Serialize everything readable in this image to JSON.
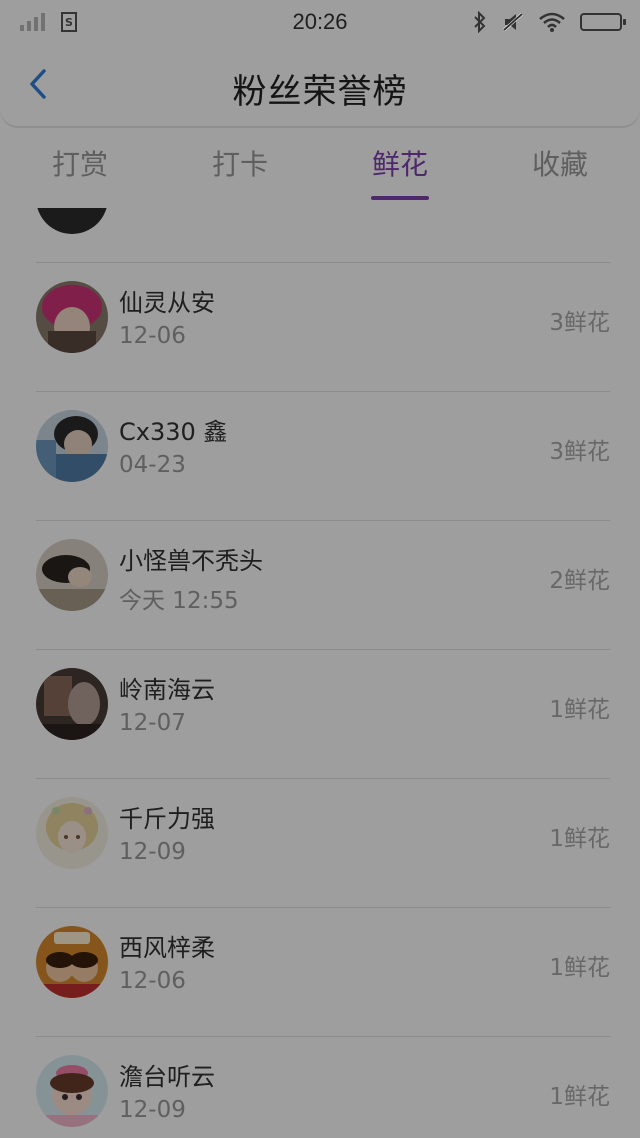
{
  "status_bar": {
    "time": "20:26",
    "sim_label": "S"
  },
  "header": {
    "title": "粉丝荣誉榜"
  },
  "tabs": [
    {
      "label": "打赏"
    },
    {
      "label": "打卡"
    },
    {
      "label": "鲜花"
    },
    {
      "label": "收藏"
    }
  ],
  "colors": {
    "accent": "#7e3fae",
    "back_icon": "#2f7fd6"
  },
  "list": [
    {
      "name": "仙灵从安",
      "date": "12-06",
      "count": "3鲜花",
      "avatar_icon": "avatar-pink-hat"
    },
    {
      "name": "Cx330 鑫",
      "date": "04-23",
      "count": "3鲜花",
      "avatar_icon": "avatar-denim"
    },
    {
      "name": "小怪兽不秃头",
      "date": "今天 12:55",
      "count": "2鲜花",
      "avatar_icon": "avatar-girl-desk"
    },
    {
      "name": "岭南海云",
      "date": "12-07",
      "count": "1鲜花",
      "avatar_icon": "avatar-dark-photo"
    },
    {
      "name": "千斤力强",
      "date": "12-09",
      "count": "1鲜花",
      "avatar_icon": "avatar-anime-girl"
    },
    {
      "name": "西风梓柔",
      "date": "12-06",
      "count": "1鲜花",
      "avatar_icon": "avatar-cartoon-couple"
    },
    {
      "name": "澹台听云",
      "date": "12-09",
      "count": "1鲜花",
      "avatar_icon": "avatar-pink-bow"
    }
  ]
}
